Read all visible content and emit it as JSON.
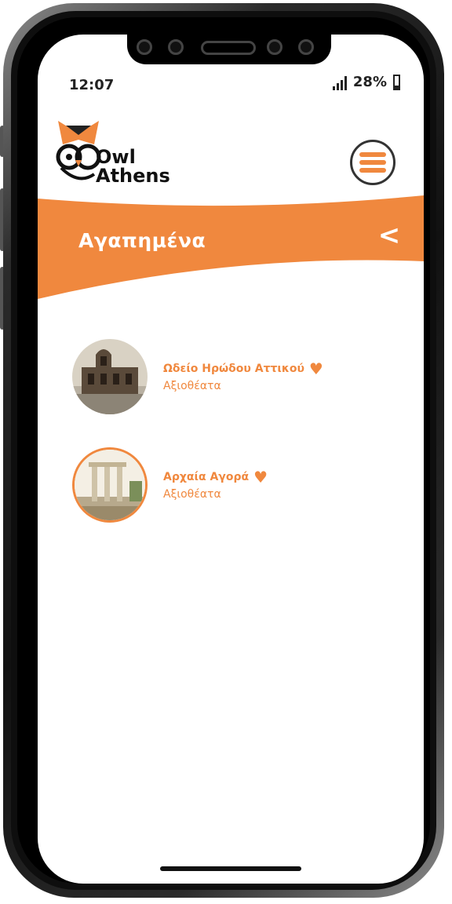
{
  "status_bar": {
    "time": "12:07",
    "battery_text": "28%",
    "battery_level": 0.28
  },
  "app": {
    "logo_line1": "Owl",
    "logo_line2": "Athens",
    "menu_icon": "hamburger-icon",
    "accent_color": "#f0883e"
  },
  "header": {
    "title": "Αγαπημένα",
    "back_icon": "chevron-left-icon",
    "back_glyph": "<"
  },
  "favorites": [
    {
      "title": "Ωδείο Ηρώδου Αττικού",
      "category": "Αξιοθέατα",
      "icon": "heart-icon"
    },
    {
      "title": "Αρχαία  Αγορά",
      "category": "Αξιοθέατα",
      "icon": "heart-icon"
    }
  ],
  "heart_glyph": "♥"
}
